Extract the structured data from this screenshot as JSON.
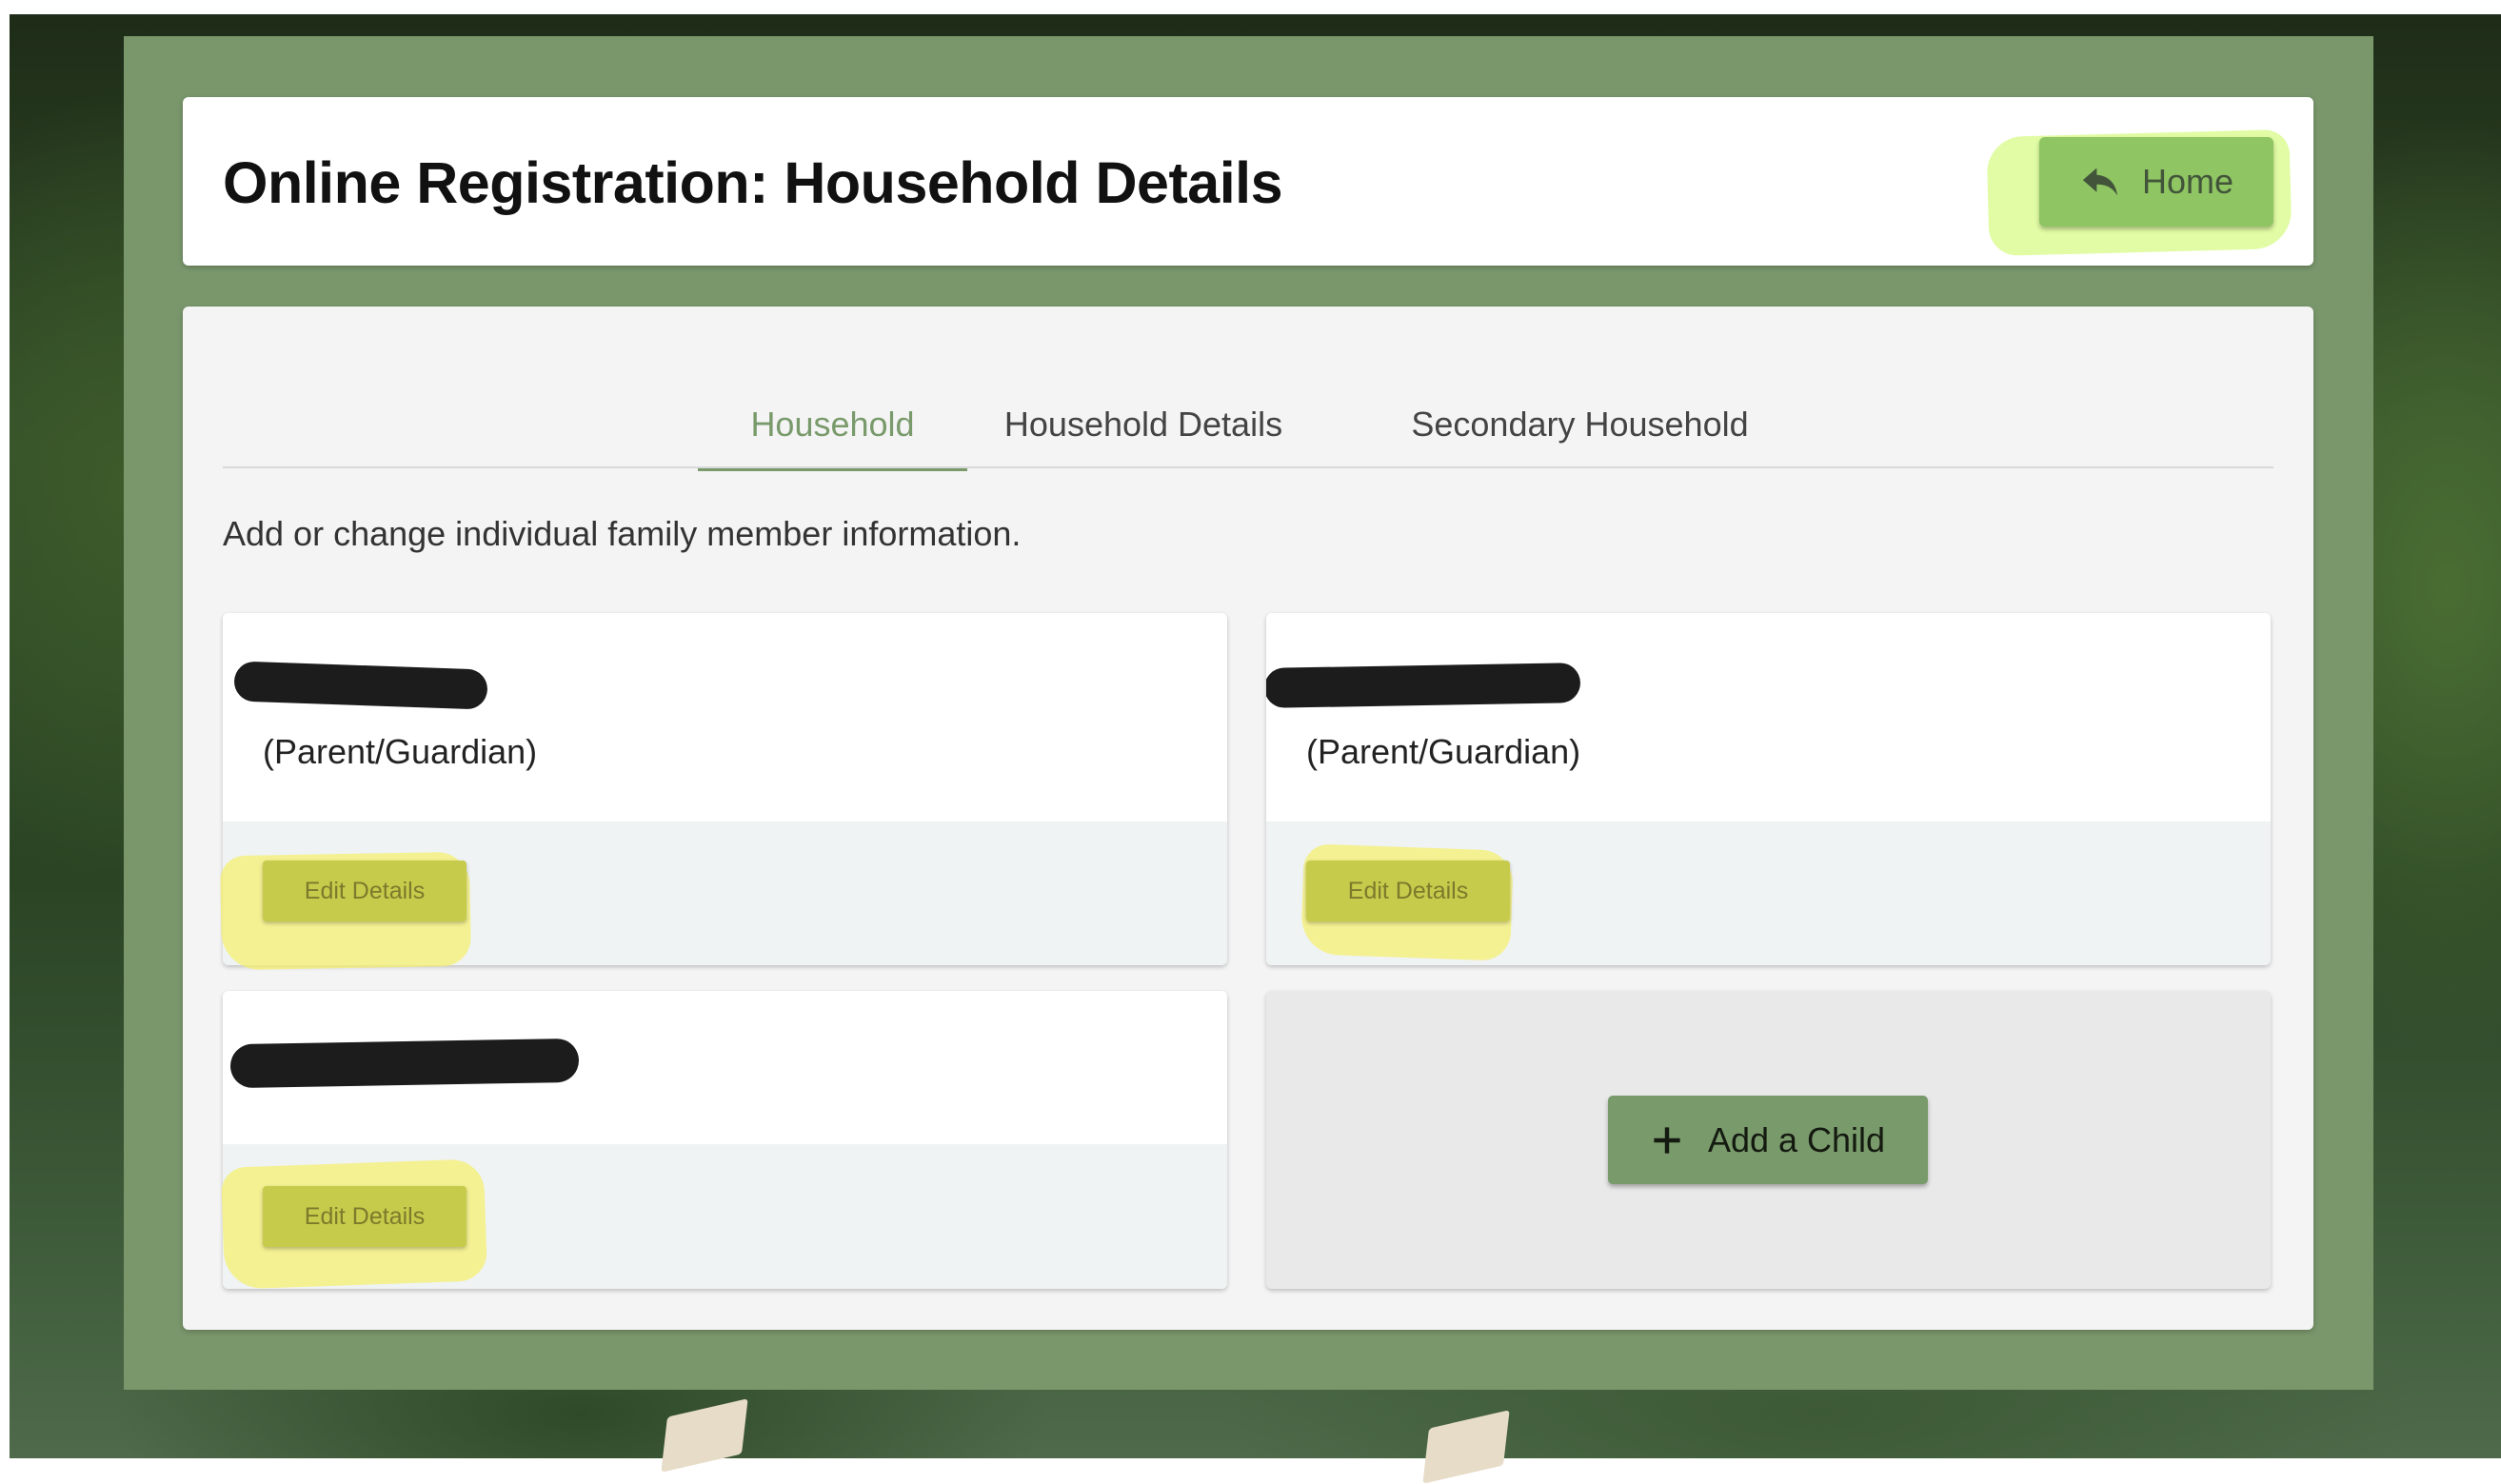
{
  "header": {
    "title": "Online Registration: Household Details",
    "home_label": "Home"
  },
  "tabs": [
    {
      "label": "Household",
      "active": true
    },
    {
      "label": "Household Details",
      "active": false
    },
    {
      "label": "Secondary Household",
      "active": false
    }
  ],
  "intro_text": "Add or change individual family member information.",
  "members": [
    {
      "name": "",
      "role": "(Parent/Guardian)",
      "edit_label": "Edit Details"
    },
    {
      "name": "",
      "role": "(Parent/Guardian)",
      "edit_label": "Edit Details"
    },
    {
      "name": "",
      "role": "",
      "edit_label": "Edit Details"
    }
  ],
  "add_child": {
    "label": "Add a Child"
  },
  "colors": {
    "frame": "#7a976c",
    "accent": "#799a6b",
    "home_button": "#8fc563",
    "edit_button": "#c7cb4b",
    "highlight_yellow": "#f5f06e",
    "highlight_green": "#c8fa5a"
  },
  "icons": {
    "home": "reply-arrow-icon",
    "add": "plus-icon"
  }
}
